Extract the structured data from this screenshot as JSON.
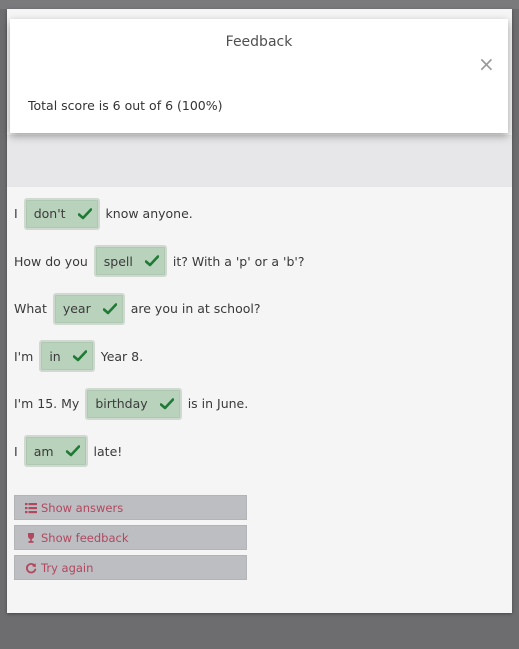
{
  "dialog": {
    "title": "Feedback",
    "close_symbol": "×",
    "score_text": "Total score is 6 out of 6 (100%)"
  },
  "sentences": [
    {
      "before": "I",
      "answer": "don't",
      "after": "know anyone."
    },
    {
      "before": "How do you",
      "answer": "spell",
      "after": "it? With a 'p' or a 'b'?"
    },
    {
      "before": "What",
      "answer": "year",
      "after": "are you in at school?"
    },
    {
      "before": "I'm",
      "answer": "in",
      "after": "Year 8."
    },
    {
      "before": "I'm 15. My",
      "answer": "birthday",
      "after": "is in June."
    },
    {
      "before": "I",
      "answer": "am",
      "after": "late!"
    }
  ],
  "buttons": {
    "show_answers": "Show answers",
    "show_feedback": "Show feedback",
    "try_again": "Try again"
  },
  "colors": {
    "correct_fill": "#b9d2bc",
    "check_color": "#1f7a35",
    "button_text": "#b1485f"
  },
  "icons": {
    "close": "close-icon",
    "check": "check-icon",
    "show_answers": "list-icon",
    "show_feedback": "trophy-icon",
    "try_again": "refresh-icon"
  }
}
